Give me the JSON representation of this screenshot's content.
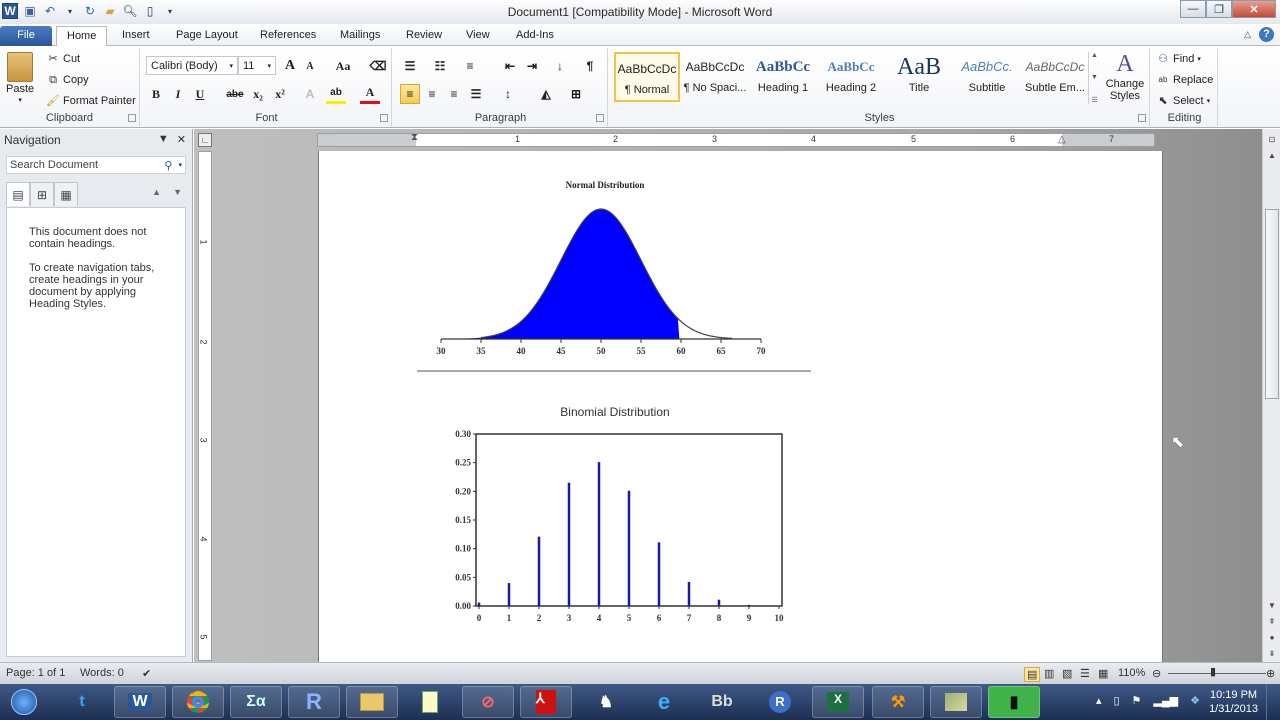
{
  "window": {
    "title": "Document1 [Compatibility Mode] - Microsoft Word",
    "app_icon": "W",
    "controls": [
      "minimize",
      "restore",
      "close"
    ]
  },
  "quick_access": [
    "save-icon",
    "undo-icon",
    "redo-icon",
    "open-icon",
    "print-preview-icon",
    "new-document-icon",
    "customize-icon"
  ],
  "tabs": [
    {
      "label": "File"
    },
    {
      "label": "Home",
      "active": true
    },
    {
      "label": "Insert"
    },
    {
      "label": "Page Layout"
    },
    {
      "label": "References"
    },
    {
      "label": "Mailings"
    },
    {
      "label": "Review"
    },
    {
      "label": "View"
    },
    {
      "label": "Add-Ins"
    }
  ],
  "ribbon": {
    "clipboard": {
      "label": "Clipboard",
      "paste": "Paste",
      "cut": "Cut",
      "copy": "Copy",
      "format_painter": "Format Painter"
    },
    "font": {
      "label": "Font",
      "font_name": "Calibri (Body)",
      "font_size": "11",
      "buttons": [
        "B",
        "I",
        "U",
        "abe",
        "x₂",
        "x²"
      ],
      "grow": "A",
      "shrink": "A",
      "change_case": "Aa"
    },
    "paragraph": {
      "label": "Paragraph"
    },
    "styles": {
      "label": "Styles",
      "items": [
        {
          "preview": "AaBbCcDc",
          "name": "¶ Normal",
          "selected": true
        },
        {
          "preview": "AaBbCcDc",
          "name": "¶ No Spaci..."
        },
        {
          "preview": "AaBbCc",
          "name": "Heading 1"
        },
        {
          "preview": "AaBbCc",
          "name": "Heading 2"
        },
        {
          "preview": "AaB",
          "name": "Title"
        },
        {
          "preview": "AaBbCc.",
          "name": "Subtitle"
        },
        {
          "preview": "AaBbCcDc",
          "name": "Subtle Em..."
        }
      ],
      "change_styles": "Change Styles"
    },
    "editing": {
      "label": "Editing",
      "find": "Find",
      "replace": "Replace",
      "select": "Select"
    }
  },
  "navigation": {
    "title": "Navigation",
    "search_placeholder": "Search Document",
    "message1": "This document does not contain headings.",
    "message2": "To create navigation tabs, create headings in your document by applying Heading Styles."
  },
  "ruler": {
    "h_numbers": [
      "1",
      "1",
      "2",
      "3",
      "4",
      "5",
      "6",
      "7"
    ],
    "v_numbers": [
      "1",
      "2",
      "3",
      "4",
      "5"
    ]
  },
  "statusbar": {
    "page": "Page: 1 of 1",
    "words": "Words: 0",
    "zoom": "110%",
    "zoom_level_percent": 110
  },
  "taskbar": {
    "apps": [
      "start",
      "tumblr",
      "word",
      "chrome",
      "math-input",
      "r-studio",
      "file-explorer",
      "notepad-plus",
      "snipping",
      "acrobat",
      "gimp",
      "internet-explorer",
      "bibtex",
      "r",
      "excel",
      "tool",
      "maps",
      "camtasia"
    ],
    "time": "10:19 PM",
    "date": "1/31/2013"
  },
  "chart_data": [
    {
      "type": "area",
      "title": "Normal Distribution",
      "xlabel": "",
      "ylabel": "",
      "mean": 50,
      "sd": 5,
      "shaded_from": 30,
      "shaded_to": 59.8,
      "xlim": [
        30,
        70
      ],
      "x_ticks": [
        30,
        35,
        40,
        45,
        50,
        55,
        60,
        65,
        70
      ],
      "x_tick_labels": [
        "30",
        "35",
        "40",
        "45",
        "50",
        "55",
        "60",
        "65",
        "70"
      ],
      "fill_color": "#0000ff",
      "grid": false
    },
    {
      "type": "bar",
      "title": "Binomial Distribution",
      "xlabel": "",
      "ylabel": "",
      "categories": [
        "0",
        "1",
        "2",
        "3",
        "4",
        "5",
        "6",
        "7",
        "8",
        "9",
        "10"
      ],
      "x": [
        0,
        1,
        2,
        3,
        4,
        5,
        6,
        7,
        8,
        9,
        10
      ],
      "values": [
        0.006,
        0.04,
        0.121,
        0.215,
        0.251,
        0.201,
        0.111,
        0.042,
        0.011,
        0.002,
        0.0001
      ],
      "ylim": [
        0,
        0.3
      ],
      "xlim": [
        0,
        10
      ],
      "y_ticks": [
        0,
        0.05,
        0.1,
        0.15,
        0.2,
        0.25,
        0.3
      ],
      "y_tick_labels": [
        "0.00",
        "0.05",
        "0.10",
        "0.15",
        "0.20",
        "0.25",
        "0.30"
      ],
      "bar_color": "#1a1aa6",
      "grid": false
    }
  ]
}
